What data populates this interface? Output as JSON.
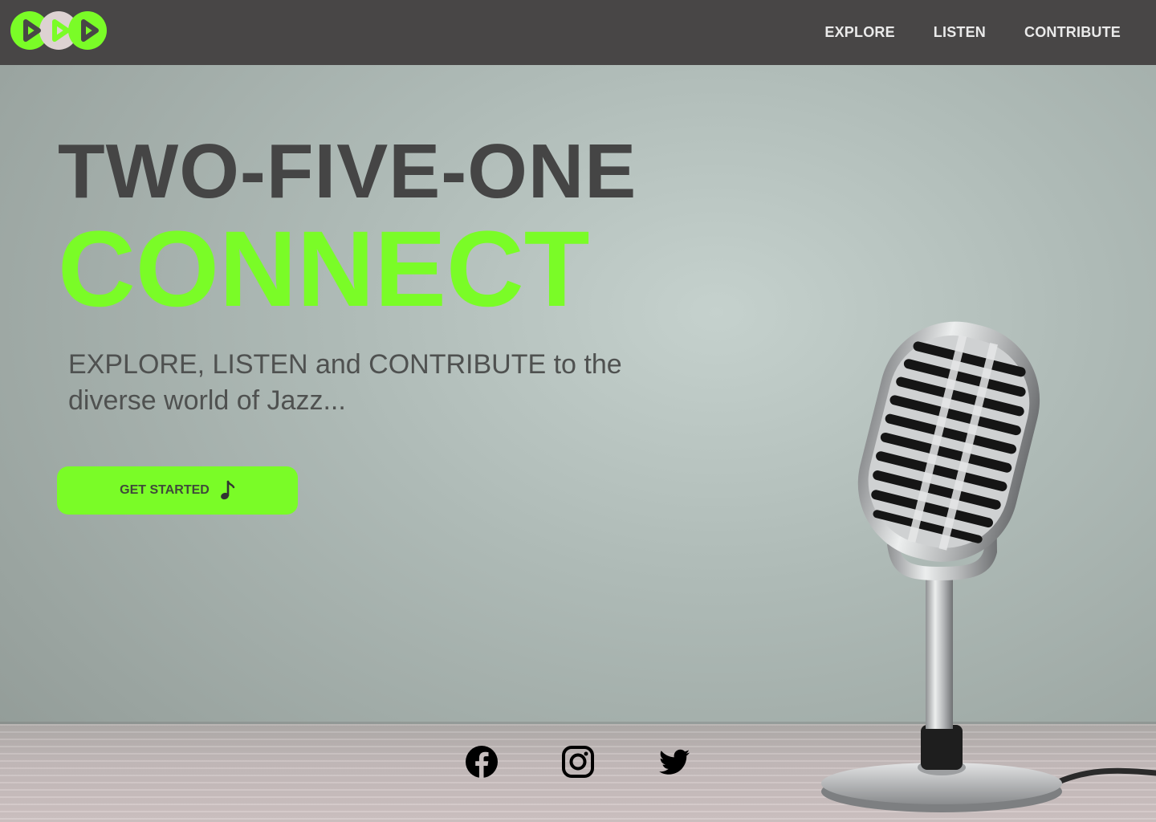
{
  "nav": {
    "links": [
      {
        "label": "EXPLORE"
      },
      {
        "label": "LISTEN"
      },
      {
        "label": "CONTRIBUTE"
      }
    ]
  },
  "hero": {
    "title": "TWO-FIVE-ONE",
    "subtitle": "CONNECT",
    "tagline": "EXPLORE, LISTEN and CONTRIBUTE to the diverse world of Jazz...",
    "cta_label": "GET STARTED",
    "cta_icon": "music-note-icon"
  },
  "social": [
    {
      "name": "facebook-icon"
    },
    {
      "name": "instagram-icon"
    },
    {
      "name": "twitter-icon"
    }
  ],
  "colors": {
    "accent": "#7afc27",
    "navbar": "#484646",
    "title": "#454545",
    "tagline": "#4f5150"
  }
}
